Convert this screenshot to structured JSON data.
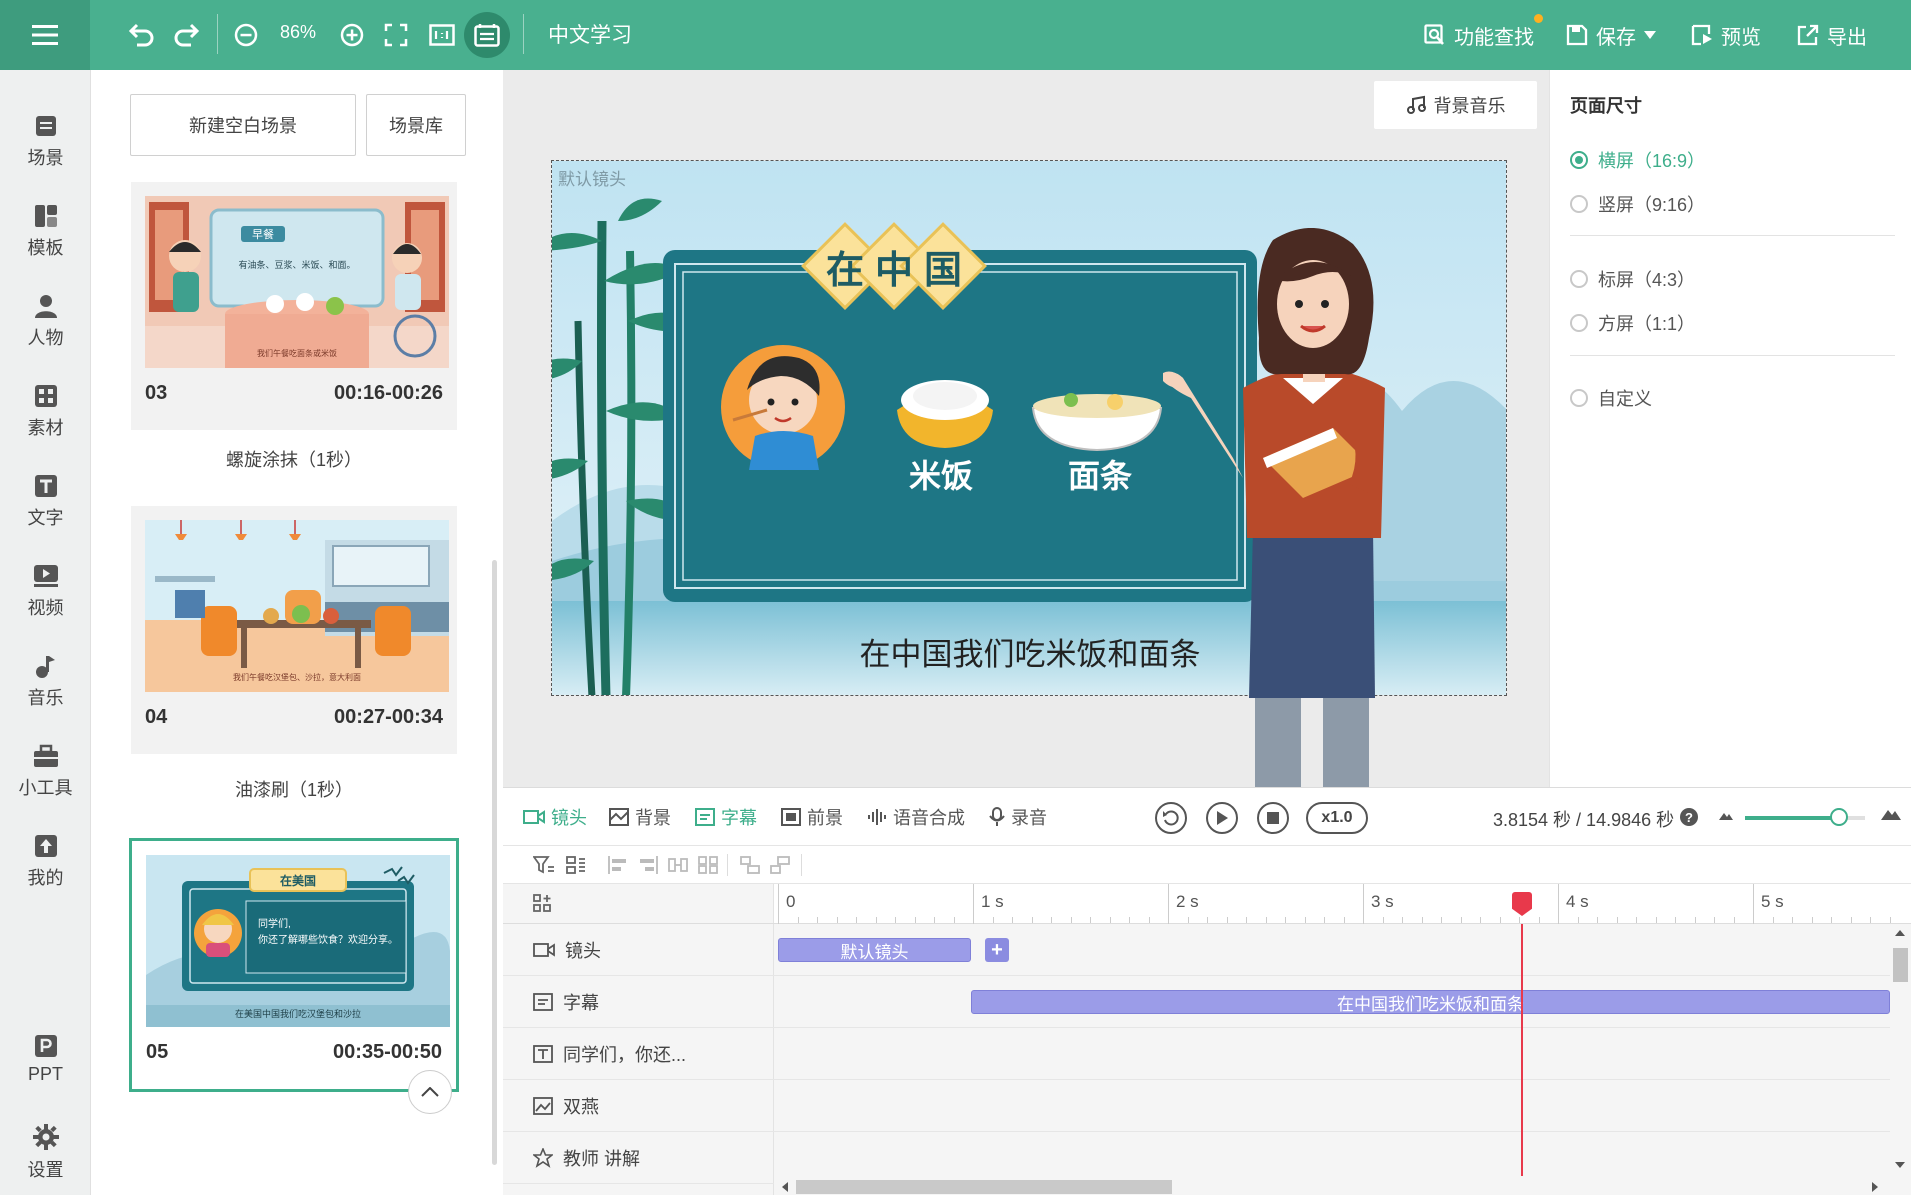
{
  "topbar": {
    "zoom": "86%",
    "title": "中文学习",
    "actions": [
      {
        "label": "功能查找",
        "icon": "search-icon"
      },
      {
        "label": "保存",
        "icon": "save-icon"
      },
      {
        "label": "预览",
        "icon": "preview-icon"
      },
      {
        "label": "导出",
        "icon": "export-icon"
      }
    ]
  },
  "leftnav": {
    "items": [
      {
        "label": "场景",
        "icon": "scene-icon"
      },
      {
        "label": "模板",
        "icon": "template-icon"
      },
      {
        "label": "人物",
        "icon": "person-icon"
      },
      {
        "label": "素材",
        "icon": "material-icon"
      },
      {
        "label": "文字",
        "icon": "text-icon"
      },
      {
        "label": "视频",
        "icon": "video-icon"
      },
      {
        "label": "音乐",
        "icon": "music-icon"
      },
      {
        "label": "小工具",
        "icon": "toolbox-icon"
      },
      {
        "label": "我的",
        "icon": "upload-icon"
      },
      {
        "label": "PPT",
        "icon": "ppt-icon"
      },
      {
        "label": "设置",
        "icon": "gear-icon"
      }
    ]
  },
  "scenes": {
    "new_blank": "新建空白场景",
    "library": "场景库",
    "cards": [
      {
        "num": "03",
        "time": "00:16-00:26",
        "thumb_title": "早餐",
        "thumb_text": "有油条、豆浆、米饭、和面。",
        "thumb_caption": "我们午餐吃面条或米饭"
      },
      {
        "num": "04",
        "time": "00:27-00:34",
        "thumb_caption": "我们午餐吃汉堡包、沙拉，意大利面"
      },
      {
        "num": "05",
        "time": "00:35-00:50",
        "thumb_title": "在美国",
        "thumb_text_1": "同学们,",
        "thumb_text_2": "你还了解哪些饮食？欢迎分享。",
        "thumb_caption": "在美国中国我们吃汉堡包和沙拉"
      }
    ],
    "transitions": [
      "螺旋涂抹（1秒）",
      "油漆刷（1秒）"
    ]
  },
  "canvas": {
    "bgm_label": "背景音乐",
    "camera_label": "默认镜头",
    "board_title_chars": [
      "在",
      "中",
      "国"
    ],
    "food_labels": [
      "米饭",
      "面条"
    ],
    "subtitle": "在中国我们吃米饭和面条"
  },
  "props": {
    "title": "页面尺寸",
    "options": [
      {
        "label": "横屏（16:9）",
        "checked": true
      },
      {
        "label": "竖屏（9:16）",
        "checked": false
      },
      {
        "label": "标屏（4:3）",
        "checked": false
      },
      {
        "label": "方屏（1:1）",
        "checked": false
      },
      {
        "label": "自定义",
        "checked": false
      }
    ]
  },
  "timeline": {
    "tabs": [
      {
        "label": "镜头",
        "icon": "camera-icon",
        "active": true
      },
      {
        "label": "背景",
        "icon": "background-icon",
        "active": false
      },
      {
        "label": "字幕",
        "icon": "caption-icon",
        "active": true
      },
      {
        "label": "前景",
        "icon": "foreground-icon",
        "active": false
      },
      {
        "label": "语音合成",
        "icon": "voice-synthesis-icon",
        "active": false
      },
      {
        "label": "录音",
        "icon": "microphone-icon",
        "active": false
      }
    ],
    "speed": "x1.0",
    "time_readout": "3.8154 秒 / 14.9846 秒",
    "zoom_level": 0.78,
    "ruler": [
      "0",
      "1 s",
      "2 s",
      "3 s",
      "4 s",
      "5 s"
    ],
    "tracks": [
      {
        "name": "镜头",
        "icon": "camera-icon"
      },
      {
        "name": "字幕",
        "icon": "caption-icon"
      },
      {
        "name": "同学们，你还...",
        "icon": "text-icon"
      },
      {
        "name": "双燕",
        "icon": "image-icon"
      },
      {
        "name": "教师 讲解",
        "icon": "character-icon"
      }
    ],
    "clips": {
      "camera": "默认镜头",
      "caption": "在中国我们吃米饭和面条"
    },
    "playhead_seconds": 3.8154
  },
  "colors": {
    "brand": "#49b08f",
    "accent": "#3eae8b",
    "playhead": "#e8394b",
    "clip": "#9b9ce8"
  }
}
